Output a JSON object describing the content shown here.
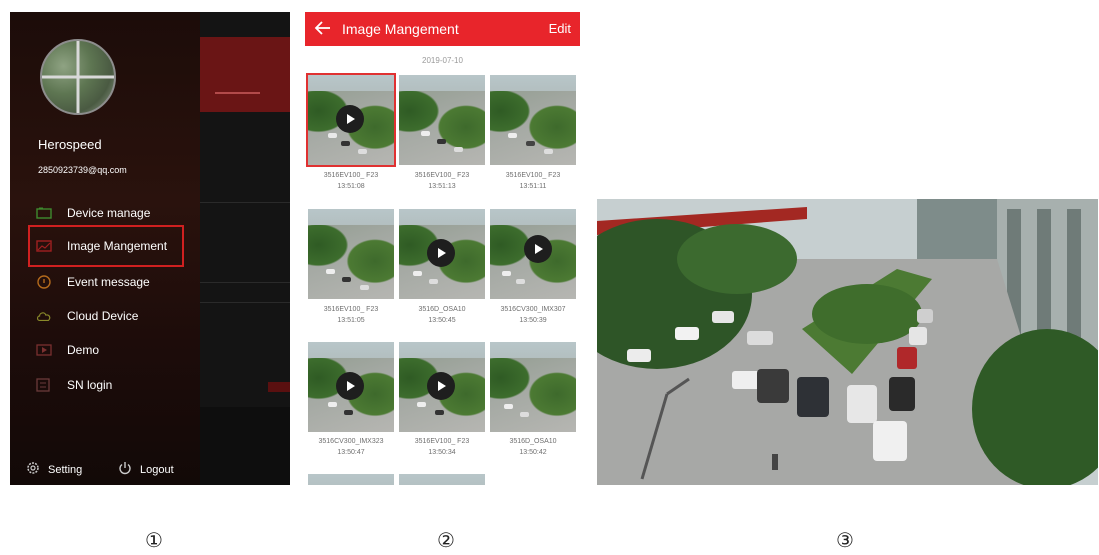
{
  "panel1": {
    "username": "Herospeed",
    "email": "2850923739@qq.com",
    "menu": [
      {
        "label": "Device manage",
        "icon": "device-icon"
      },
      {
        "label": "Image Mangement",
        "icon": "image-icon",
        "highlighted": true
      },
      {
        "label": "Event message",
        "icon": "event-icon"
      },
      {
        "label": "Cloud Device",
        "icon": "cloud-icon"
      },
      {
        "label": "Demo",
        "icon": "demo-icon"
      },
      {
        "label": "SN login",
        "icon": "sn-login-icon"
      }
    ],
    "footer": {
      "setting": "Setting",
      "logout": "Logout"
    },
    "highlight_color": "#d02020"
  },
  "panel2": {
    "title": "Image Mangement",
    "edit": "Edit",
    "date": "2019-07-10",
    "accent": "#e8252b",
    "thumbs": [
      {
        "name": "3516EV100_ F23",
        "time": "13:51:08",
        "video": true,
        "selected": true
      },
      {
        "name": "3516EV100_ F23",
        "time": "13:51:13",
        "video": false
      },
      {
        "name": "3516EV100_ F23",
        "time": "13:51:11",
        "video": false
      },
      {
        "name": "3516EV100_ F23",
        "time": "13:51:05",
        "video": false
      },
      {
        "name": "3516D_OSA10",
        "time": "13:50:45",
        "video": true
      },
      {
        "name": "3516CV300_IMX307",
        "time": "13:50:39",
        "video": true
      },
      {
        "name": "3516CV300_IMX323",
        "time": "13:50:47",
        "video": true
      },
      {
        "name": "3516EV100_ F23",
        "time": "13:50:34",
        "video": true
      },
      {
        "name": "3516D_OSA10",
        "time": "13:50:42",
        "video": false
      }
    ]
  },
  "labels": [
    "①",
    "②",
    "③"
  ]
}
